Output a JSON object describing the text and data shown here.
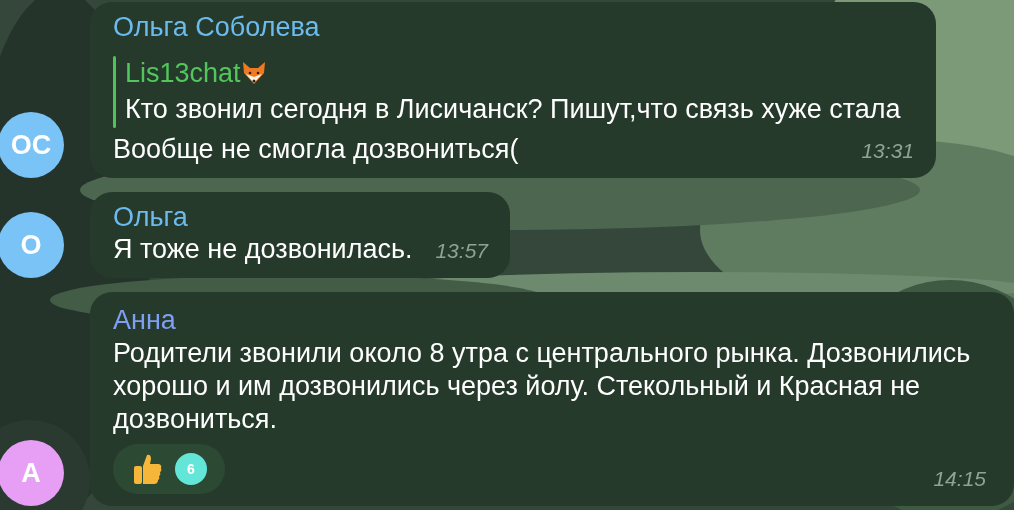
{
  "messages": [
    {
      "author": {
        "name": "Ольга Соболева",
        "color": "#6cbbef"
      },
      "avatar": {
        "initials": "ОС",
        "color": "#79c3f7"
      },
      "reply": {
        "author": "Lis13chat",
        "text": "Кто звонил сегодня в Лисичанск? Пишут,что связь хуже стала"
      },
      "text": "Вообще не смогла дозвониться(",
      "time": "13:31"
    },
    {
      "author": {
        "name": "Ольга",
        "color": "#6cbbef"
      },
      "avatar": {
        "initials": "О",
        "color": "#79c3f7"
      },
      "text": "Я тоже не дозвонилась.",
      "time": "13:57"
    },
    {
      "author": {
        "name": "Анна",
        "color": "#7f9ff3"
      },
      "avatar": {
        "initials": "А",
        "color": "#e79ff5"
      },
      "text": "Родители звонили около 8 утра с центрального рынка. Дозвонились хорошо и им дозвонились через йолу. Стекольный и Красная не дозвониться.",
      "reactions": [
        {
          "count": "6"
        }
      ],
      "time": "14:15"
    }
  ]
}
